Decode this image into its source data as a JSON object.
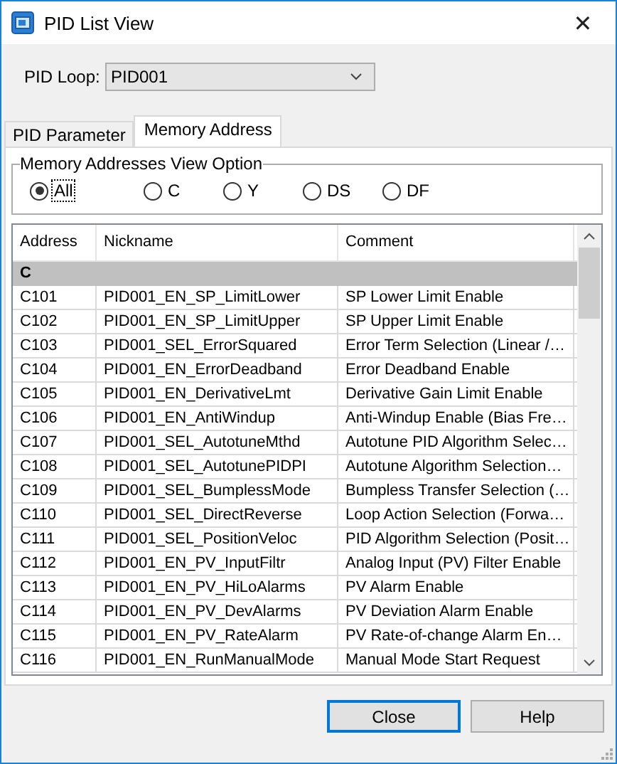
{
  "window": {
    "title": "PID List View",
    "close": "✕"
  },
  "pid_loop": {
    "label": "PID Loop:",
    "value": "PID001"
  },
  "tabs": [
    {
      "label": "PID Parameter",
      "selected": false
    },
    {
      "label": "Memory Address",
      "selected": true
    }
  ],
  "view_option": {
    "title": "Memory Addresses View Option",
    "options": [
      {
        "label": "All",
        "selected": true
      },
      {
        "label": "C",
        "selected": false
      },
      {
        "label": "Y",
        "selected": false
      },
      {
        "label": "DS",
        "selected": false
      },
      {
        "label": "DF",
        "selected": false
      }
    ]
  },
  "table": {
    "columns": [
      "Address",
      "Nickname",
      "Comment"
    ],
    "group": "C",
    "rows": [
      [
        "C101",
        "PID001_EN_SP_LimitLower",
        "SP Lower Limit Enable"
      ],
      [
        "C102",
        "PID001_EN_SP_LimitUpper",
        "SP Upper Limit Enable"
      ],
      [
        "C103",
        "PID001_SEL_ErrorSquared",
        "Error Term Selection (Linear /…"
      ],
      [
        "C104",
        "PID001_EN_ErrorDeadband",
        "Error Deadband Enable"
      ],
      [
        "C105",
        "PID001_EN_DerivativeLmt",
        "Derivative Gain Limit Enable"
      ],
      [
        "C106",
        "PID001_EN_AntiWindup",
        "Anti-Windup Enable (Bias Fre…"
      ],
      [
        "C107",
        "PID001_SEL_AutotuneMthd",
        "Autotune PID Algorithm Selec…"
      ],
      [
        "C108",
        "PID001_SEL_AutotunePIDPI",
        "Autotune Algorithm Selection…"
      ],
      [
        "C109",
        "PID001_SEL_BumplessMode",
        "Bumpless Transfer Selection (…"
      ],
      [
        "C110",
        "PID001_SEL_DirectReverse",
        "Loop Action Selection (Forwa…"
      ],
      [
        "C111",
        "PID001_SEL_PositionVeloc",
        "PID Algorithm Selection (Posit…"
      ],
      [
        "C112",
        "PID001_EN_PV_InputFiltr",
        "Analog Input (PV) Filter Enable"
      ],
      [
        "C113",
        "PID001_EN_PV_HiLoAlarms",
        "PV Alarm Enable"
      ],
      [
        "C114",
        "PID001_EN_PV_DevAlarms",
        "PV Deviation Alarm Enable"
      ],
      [
        "C115",
        "PID001_EN_PV_RateAlarm",
        "PV Rate-of-change Alarm En…"
      ],
      [
        "C116",
        "PID001_EN_RunManualMode",
        "Manual Mode Start Request"
      ]
    ]
  },
  "buttons": [
    {
      "label": "Close",
      "selected": true
    },
    {
      "label": "Help",
      "selected": false
    }
  ]
}
